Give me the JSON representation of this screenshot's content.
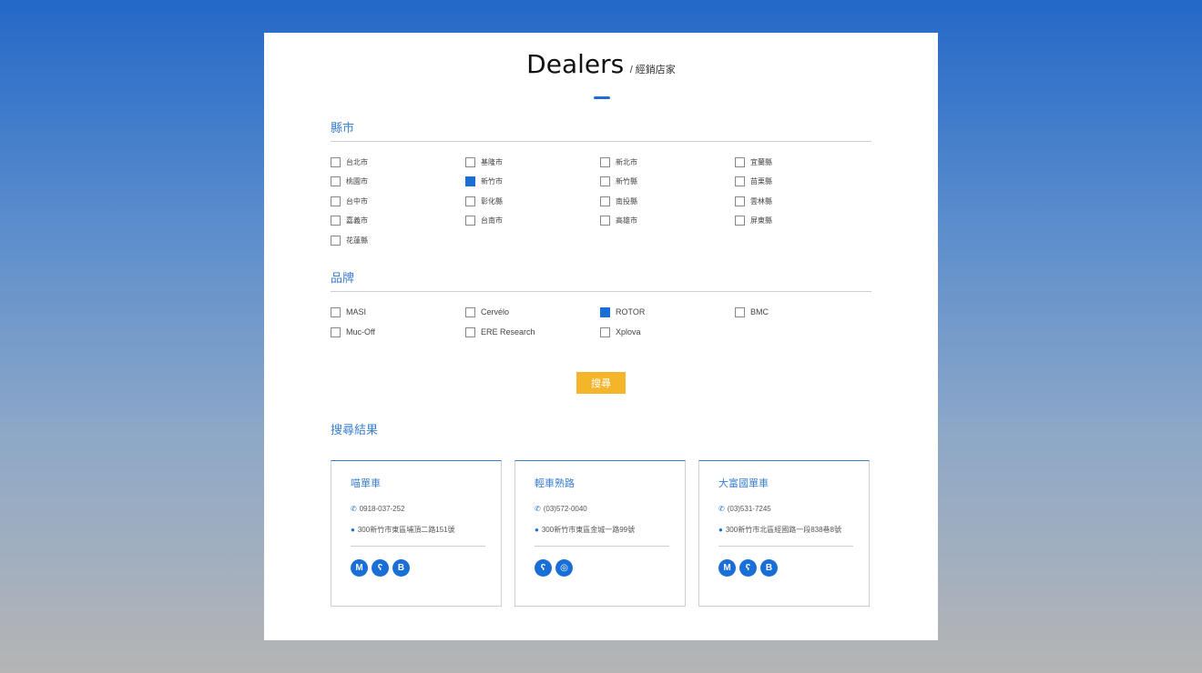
{
  "title": {
    "main": "Dealers",
    "sub": "/ 經銷店家"
  },
  "region_section": {
    "heading": "縣市",
    "items": [
      {
        "label": "台北市",
        "checked": false
      },
      {
        "label": "基隆市",
        "checked": false
      },
      {
        "label": "新北市",
        "checked": false
      },
      {
        "label": "宜蘭縣",
        "checked": false
      },
      {
        "label": "桃園市",
        "checked": false
      },
      {
        "label": "新竹市",
        "checked": true
      },
      {
        "label": "新竹縣",
        "checked": false
      },
      {
        "label": "苗栗縣",
        "checked": false
      },
      {
        "label": "台中市",
        "checked": false
      },
      {
        "label": "彰化縣",
        "checked": false
      },
      {
        "label": "南投縣",
        "checked": false
      },
      {
        "label": "雲林縣",
        "checked": false
      },
      {
        "label": "嘉義市",
        "checked": false
      },
      {
        "label": "台南市",
        "checked": false
      },
      {
        "label": "高雄市",
        "checked": false
      },
      {
        "label": "屏東縣",
        "checked": false
      },
      {
        "label": "花蓮縣",
        "checked": false
      }
    ]
  },
  "brand_section": {
    "heading": "品牌",
    "items": [
      {
        "label": "MASI",
        "checked": false
      },
      {
        "label": "Cervélo",
        "checked": false
      },
      {
        "label": "ROTOR",
        "checked": true
      },
      {
        "label": "BMC",
        "checked": false
      },
      {
        "label": "Muc-Off",
        "checked": false
      },
      {
        "label": "ERE Research",
        "checked": false
      },
      {
        "label": "Xplova",
        "checked": false
      }
    ]
  },
  "search_button": "搜尋",
  "results": {
    "heading": "搜尋結果",
    "dealers": [
      {
        "name": "喵單車",
        "phone": "0918-037-252",
        "address": "300新竹市東區埔頂二路151號",
        "brands": [
          {
            "glyph": "M",
            "icon": "masi-icon"
          },
          {
            "glyph": "ʕ",
            "icon": "muc-off-icon"
          },
          {
            "glyph": "B",
            "icon": "bmc-icon"
          }
        ]
      },
      {
        "name": "輕車熟路",
        "phone": "(03)572-0040",
        "address": "300新竹市東區金城一路99號",
        "brands": [
          {
            "glyph": "ʕ",
            "icon": "muc-off-icon"
          },
          {
            "glyph": "◎",
            "icon": "rotor-icon"
          }
        ]
      },
      {
        "name": "大富國單車",
        "phone": "(03)531-7245",
        "address": "300新竹市北區經國路一段838巷8號",
        "brands": [
          {
            "glyph": "M",
            "icon": "masi-icon"
          },
          {
            "glyph": "ʕ",
            "icon": "muc-off-icon"
          },
          {
            "glyph": "B",
            "icon": "bmc-icon"
          }
        ]
      }
    ]
  },
  "icons": {
    "phone": "phone-icon",
    "location": "location-pin-icon"
  },
  "colors": {
    "accent": "#1a6fd6",
    "button": "#f5b52b",
    "heading": "#3a7fd0"
  }
}
